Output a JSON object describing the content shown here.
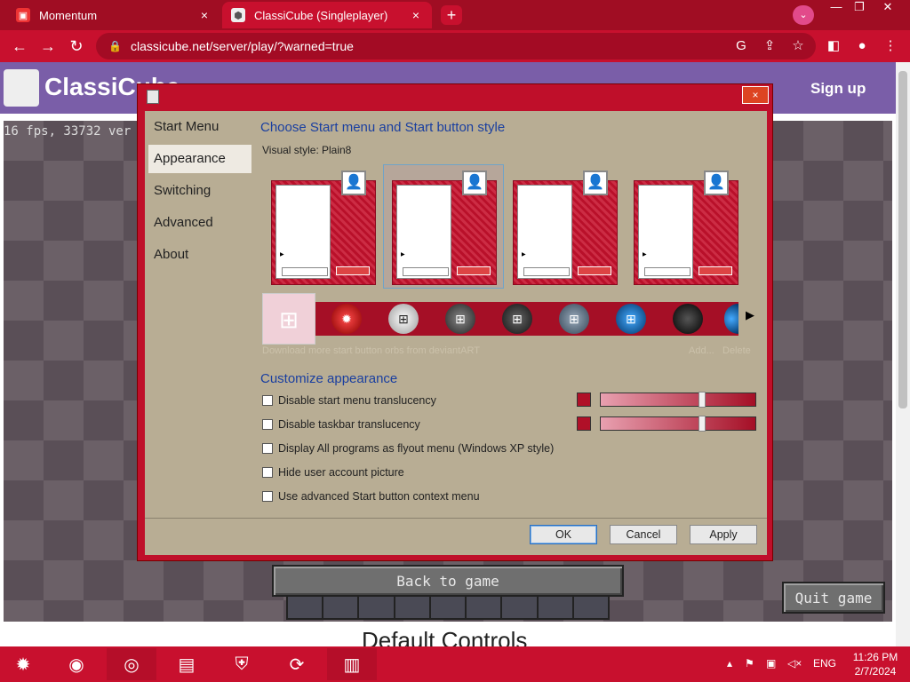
{
  "browser": {
    "tabs": [
      {
        "title": "Momentum",
        "active": false
      },
      {
        "title": "ClassiCube (Singleplayer)",
        "active": true
      }
    ],
    "url": "classicube.net/server/play/?warned=true",
    "new_tab": "+",
    "close": "×"
  },
  "site": {
    "logo": "ClassiCube",
    "signup": "Sign up",
    "fps": "16 fps, 33732 ver",
    "back_to_game": "Back to game",
    "quit_game": "Quit game",
    "default_controls": "Default Controls"
  },
  "dialog": {
    "close": "×",
    "nav": [
      "Start Menu",
      "Appearance",
      "Switching",
      "Advanced",
      "About"
    ],
    "heading": "Choose Start menu and Start button style",
    "visual_style_label": "Visual style:",
    "visual_style_value": "Plain8",
    "download_link": "Download more start button orbs from deviantART",
    "add": "Add...",
    "delete": "Delete",
    "customize_heading": "Customize appearance",
    "options": [
      "Disable start menu translucency",
      "Disable taskbar translucency",
      "Display All programs as flyout menu (Windows XP style)",
      "Hide user account picture",
      "Use advanced Start button context menu"
    ],
    "ok": "OK",
    "cancel": "Cancel",
    "apply": "Apply",
    "slider_levels": [
      0.66,
      0.66
    ]
  },
  "taskbar": {
    "lang": "ENG",
    "time": "11:26 PM",
    "date": "2/7/2024"
  },
  "colors": {
    "accent": "#c8102e",
    "dialog_bg": "#b8ad94",
    "heading": "#1a3fa0"
  }
}
